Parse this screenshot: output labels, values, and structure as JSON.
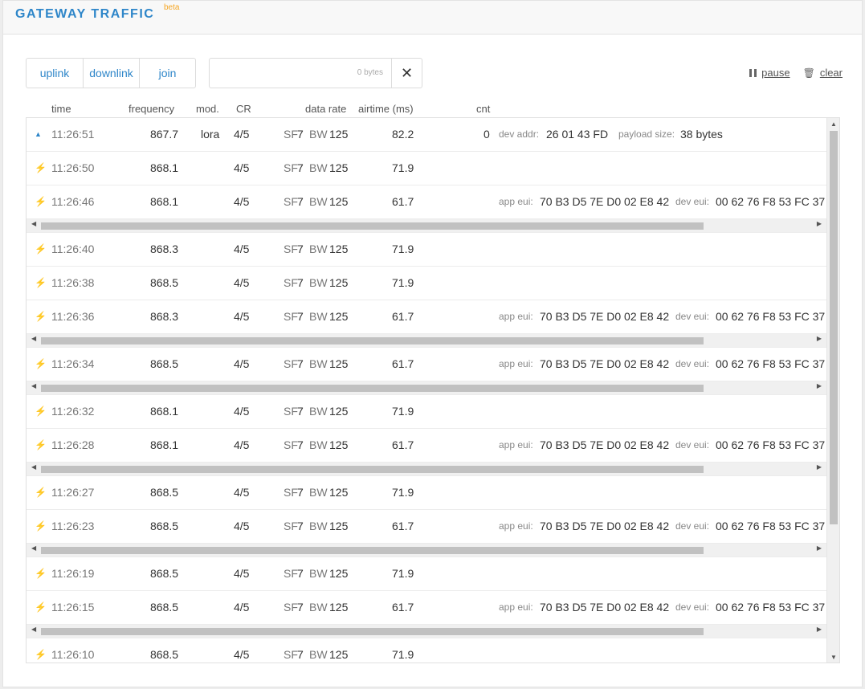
{
  "header": {
    "title": "GATEWAY TRAFFIC",
    "badge": "beta"
  },
  "filters": {
    "uplink": "uplink",
    "downlink": "downlink",
    "join": "join"
  },
  "search": {
    "value": "",
    "bytes_hint": "0 bytes",
    "clear_glyph": "✕"
  },
  "toolbar": {
    "pause": "pause",
    "clear": "clear"
  },
  "columns": {
    "time": "time",
    "frequency": "frequency",
    "mod": "mod.",
    "cr": "CR",
    "data_rate": "data rate",
    "airtime": "airtime (ms)",
    "cnt": "cnt"
  },
  "labels": {
    "sf": "SF",
    "bw": "BW",
    "dev_addr": "dev addr:",
    "payload_size": "payload size:",
    "app_eui": "app eui:",
    "dev_eui": "dev eui:"
  },
  "colors": {
    "accent": "#2e86c9",
    "beta": "#f5a623",
    "bolt_green": "#6ac04f",
    "bolt_orange": "#f5a623"
  },
  "rows": [
    {
      "kind": "uplink",
      "icon": "up-icon",
      "time": "11:26:51",
      "freq": "867.7",
      "mod": "lora",
      "cr": "4/5",
      "sf": "7",
      "bw": "125",
      "airtime": "82.2",
      "cnt": "0",
      "dev_addr": "26 01 43 FD",
      "payload_size": "38 bytes",
      "scroll": false
    },
    {
      "kind": "green",
      "icon": "bolt-icon",
      "time": "11:26:50",
      "freq": "868.1",
      "cr": "4/5",
      "sf": "7",
      "bw": "125",
      "airtime": "71.9",
      "scroll": false
    },
    {
      "kind": "orange",
      "icon": "bolt-icon",
      "time": "11:26:46",
      "freq": "868.1",
      "cr": "4/5",
      "sf": "7",
      "bw": "125",
      "airtime": "61.7",
      "app_eui": "70 B3 D5 7E D0 02 E8 42",
      "dev_eui": "00 62 76 F8 53 FC 37",
      "scroll": true
    },
    {
      "kind": "green",
      "icon": "bolt-icon",
      "time": "11:26:40",
      "freq": "868.3",
      "cr": "4/5",
      "sf": "7",
      "bw": "125",
      "airtime": "71.9",
      "scroll": false
    },
    {
      "kind": "green",
      "icon": "bolt-icon",
      "time": "11:26:38",
      "freq": "868.5",
      "cr": "4/5",
      "sf": "7",
      "bw": "125",
      "airtime": "71.9",
      "scroll": false
    },
    {
      "kind": "orange",
      "icon": "bolt-icon",
      "time": "11:26:36",
      "freq": "868.3",
      "cr": "4/5",
      "sf": "7",
      "bw": "125",
      "airtime": "61.7",
      "app_eui": "70 B3 D5 7E D0 02 E8 42",
      "dev_eui": "00 62 76 F8 53 FC 37",
      "scroll": true
    },
    {
      "kind": "orange",
      "icon": "bolt-icon",
      "time": "11:26:34",
      "freq": "868.5",
      "cr": "4/5",
      "sf": "7",
      "bw": "125",
      "airtime": "61.7",
      "app_eui": "70 B3 D5 7E D0 02 E8 42",
      "dev_eui": "00 62 76 F8 53 FC 37",
      "scroll": true
    },
    {
      "kind": "green",
      "icon": "bolt-icon",
      "time": "11:26:32",
      "freq": "868.1",
      "cr": "4/5",
      "sf": "7",
      "bw": "125",
      "airtime": "71.9",
      "scroll": false
    },
    {
      "kind": "orange",
      "icon": "bolt-icon",
      "time": "11:26:28",
      "freq": "868.1",
      "cr": "4/5",
      "sf": "7",
      "bw": "125",
      "airtime": "61.7",
      "app_eui": "70 B3 D5 7E D0 02 E8 42",
      "dev_eui": "00 62 76 F8 53 FC 37",
      "scroll": true
    },
    {
      "kind": "green",
      "icon": "bolt-icon",
      "time": "11:26:27",
      "freq": "868.5",
      "cr": "4/5",
      "sf": "7",
      "bw": "125",
      "airtime": "71.9",
      "scroll": false
    },
    {
      "kind": "orange",
      "icon": "bolt-icon",
      "time": "11:26:23",
      "freq": "868.5",
      "cr": "4/5",
      "sf": "7",
      "bw": "125",
      "airtime": "61.7",
      "app_eui": "70 B3 D5 7E D0 02 E8 42",
      "dev_eui": "00 62 76 F8 53 FC 37",
      "scroll": true
    },
    {
      "kind": "green",
      "icon": "bolt-icon",
      "time": "11:26:19",
      "freq": "868.5",
      "cr": "4/5",
      "sf": "7",
      "bw": "125",
      "airtime": "71.9",
      "scroll": false
    },
    {
      "kind": "orange",
      "icon": "bolt-icon",
      "time": "11:26:15",
      "freq": "868.5",
      "cr": "4/5",
      "sf": "7",
      "bw": "125",
      "airtime": "61.7",
      "app_eui": "70 B3 D5 7E D0 02 E8 42",
      "dev_eui": "00 62 76 F8 53 FC 37",
      "scroll": true
    },
    {
      "kind": "green",
      "icon": "bolt-icon",
      "time": "11:26:10",
      "freq": "868.5",
      "cr": "4/5",
      "sf": "7",
      "bw": "125",
      "airtime": "71.9",
      "scroll": false
    }
  ]
}
